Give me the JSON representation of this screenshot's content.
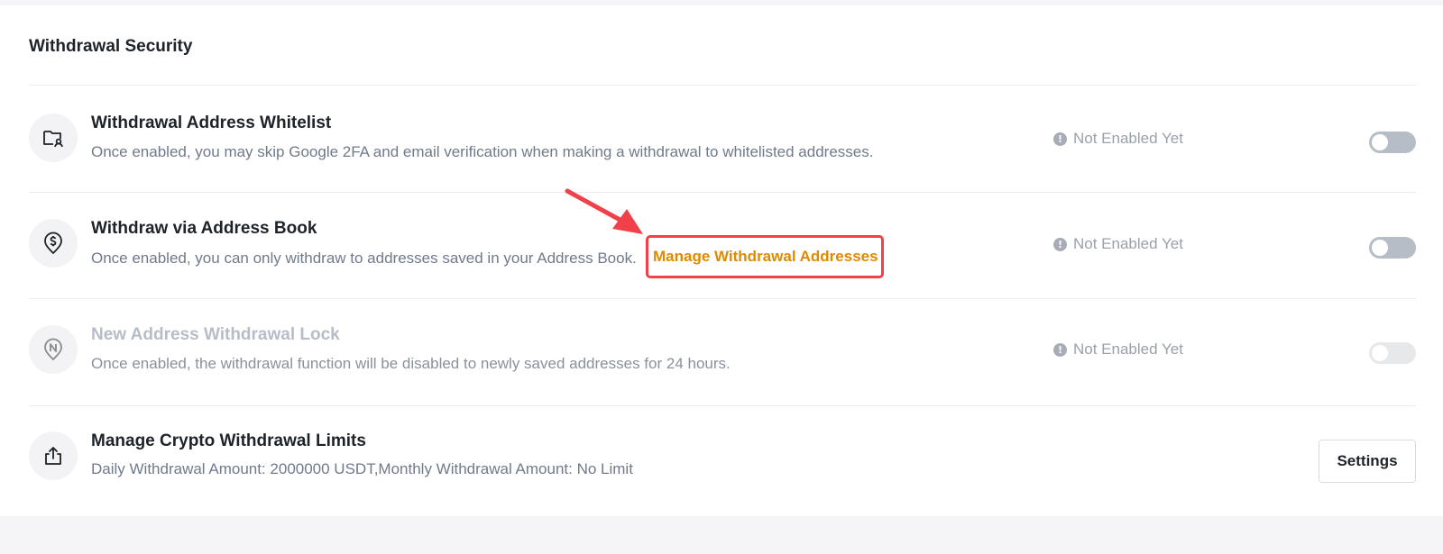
{
  "section": {
    "title": "Withdrawal Security"
  },
  "rows": [
    {
      "title": "Withdrawal Address Whitelist",
      "description": "Once enabled, you may skip Google 2FA and email verification when making a withdrawal to whitelisted addresses.",
      "status": "Not Enabled Yet",
      "icon": "address-whitelist-icon",
      "toggle_on": false
    },
    {
      "title": "Withdraw via Address Book",
      "description": "Once enabled, you can only withdraw to addresses saved in your Address Book.",
      "link": "Manage Withdrawal Addresses",
      "status": "Not Enabled Yet",
      "icon": "dollar-pin-icon",
      "toggle_on": false
    },
    {
      "title": "New Address Withdrawal Lock",
      "description": "Once enabled, the withdrawal function will be disabled to newly saved addresses for 24 hours.",
      "status": "Not Enabled Yet",
      "icon": "new-address-pin-icon",
      "toggle_on": false,
      "disabled": true
    },
    {
      "title": "Manage Crypto Withdrawal Limits",
      "description": "Daily Withdrawal Amount: 2000000 USDT,Monthly Withdrawal Amount: No Limit",
      "button": "Settings",
      "icon": "upload-tray-icon"
    }
  ],
  "colors": {
    "link": "#e08a00",
    "highlight_box": "#f0404a",
    "annotation_arrow": "#f0404a"
  }
}
